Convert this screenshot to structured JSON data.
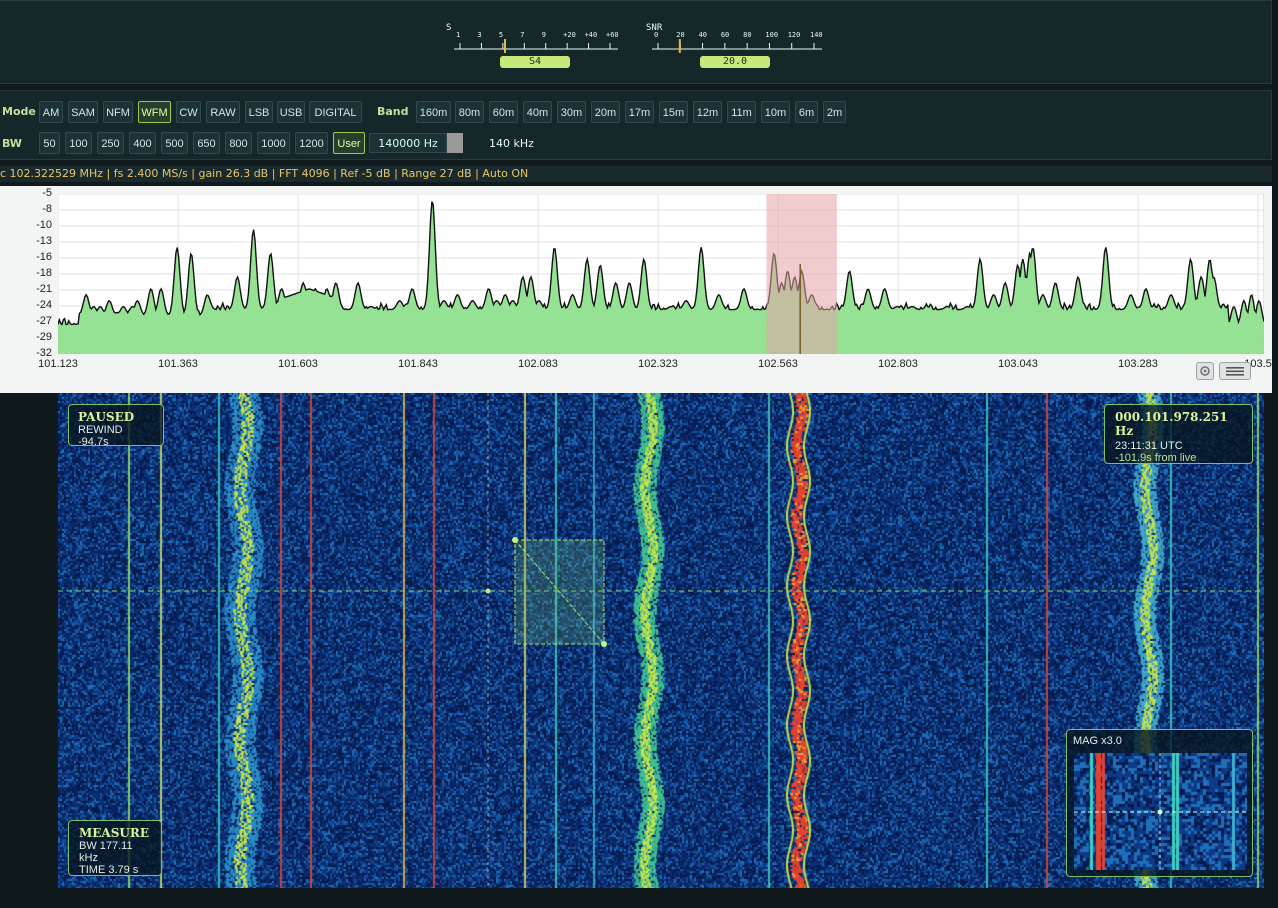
{
  "meters": {
    "s": {
      "title": "S",
      "ticks": [
        "1",
        "3",
        "5",
        "7",
        "9",
        "+20",
        "+40",
        "+60"
      ],
      "value": "S4",
      "needle_fraction": 0.3
    },
    "snr": {
      "title": "SNR",
      "ticks": [
        "0",
        "20",
        "40",
        "60",
        "80",
        "100",
        "120",
        "140"
      ],
      "value": "20.0",
      "needle_fraction": 0.14
    }
  },
  "mode": {
    "label": "Mode",
    "buttons": [
      "AM",
      "SAM",
      "NFM",
      "WFM",
      "CW",
      "RAW",
      "LSB",
      "USB",
      "DIGITAL"
    ],
    "active": "WFM"
  },
  "band": {
    "label": "Band",
    "buttons": [
      "160m",
      "80m",
      "60m",
      "40m",
      "30m",
      "20m",
      "17m",
      "15m",
      "12m",
      "11m",
      "10m",
      "6m",
      "2m"
    ]
  },
  "bw": {
    "label": "BW",
    "buttons": [
      "50",
      "100",
      "250",
      "400",
      "500",
      "650",
      "800",
      "1000",
      "1200",
      "User"
    ],
    "active": "User",
    "field_value": "140000 Hz",
    "readout": "140 kHz"
  },
  "status": "c 102.322529 MHz | fs 2.400 MS/s | gain 26.3 dB | FFT 4096 | Ref -5 dB | Range 27 dB | Auto ON",
  "spectrum": {
    "y_ticks": [
      "-5",
      "-8",
      "-10",
      "-13",
      "-16",
      "-18",
      "-21",
      "-24",
      "-27",
      "-29",
      "-32"
    ],
    "x_ticks": [
      "101.123",
      "101.363",
      "101.603",
      "101.843",
      "102.083",
      "102.323",
      "102.563",
      "102.803",
      "103.043",
      "103.283",
      "103.5"
    ],
    "y_range": [
      -32,
      -5
    ],
    "x_range": [
      101.123,
      103.523
    ],
    "passband_mhz": [
      102.533,
      102.673
    ],
    "tuned_mhz": 102.6,
    "fill_color": "#8fe08f",
    "passband_color": "#e6a3a8"
  },
  "waterfall": {
    "paused": {
      "title": "PAUSED",
      "rewind": "REWIND -94.7s"
    },
    "cursor": {
      "freq": "000.101.978.251 Hz",
      "time": "23:11:31 UTC",
      "from_live": "-101.9s from live"
    },
    "measure": {
      "title": "MEASURE",
      "bw": "BW 177.11 kHz",
      "time": "TIME 3.79 s"
    },
    "mag": {
      "title": "MAG x3.0"
    }
  }
}
